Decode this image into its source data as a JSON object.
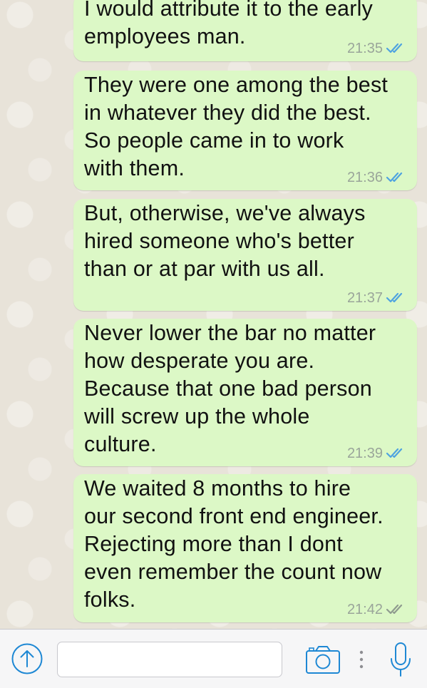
{
  "messages": [
    {
      "text": "I would attribute it to the early\nemployees man.",
      "time": "21:35",
      "status": "read"
    },
    {
      "text": "They were one among the best\nin whatever they did the best.\nSo people came in to work\nwith them.",
      "time": "21:36",
      "status": "read"
    },
    {
      "text": "But, otherwise, we've always\nhired someone who's better\nthan or at par with us all.",
      "time": "21:37",
      "status": "read"
    },
    {
      "text": "Never lower the bar no matter\nhow desperate you are.\nBecause that one bad person\nwill screw up the whole\nculture.",
      "time": "21:39",
      "status": "read"
    },
    {
      "text": "We waited 8 months to hire\nour second front end engineer.\nRejecting more than I dont\neven remember the count now\nfolks.",
      "time": "21:42",
      "status": "delivered"
    }
  ],
  "input_bar": {
    "attach_icon": "upload-arrow-icon",
    "message_placeholder": "",
    "camera_icon": "camera-icon",
    "more_icon": "vertical-dots-icon",
    "mic_icon": "microphone-icon"
  },
  "colors": {
    "outgoing_bubble": "#dcf8c6",
    "read_ticks": "#4fa3e0",
    "delivered_ticks": "#8f9b8f",
    "accent": "#1e88d4",
    "timestamp": "#9aa59a"
  }
}
